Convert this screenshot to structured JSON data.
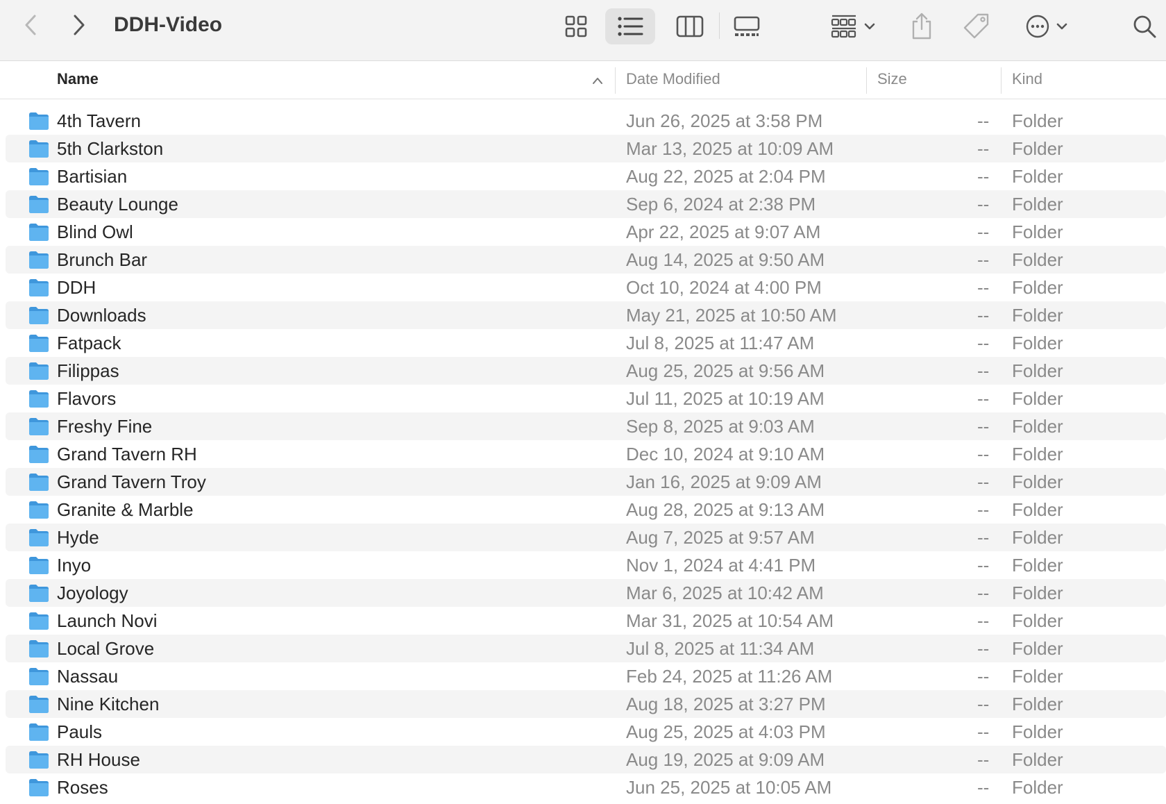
{
  "window": {
    "title": "DDH-Video"
  },
  "toolbar": {
    "back_icon": "chevron-left-icon",
    "forward_icon": "chevron-right-icon",
    "view_modes": [
      "icon-view",
      "list-view",
      "column-view",
      "gallery-view"
    ],
    "active_view": "list-view",
    "icons": [
      "group-icon",
      "share-icon",
      "tag-icon",
      "more-icon",
      "search-icon"
    ]
  },
  "columns": {
    "name": "Name",
    "date_modified": "Date Modified",
    "size": "Size",
    "kind": "Kind",
    "sort_column": "name",
    "sort_direction": "ascending"
  },
  "colors": {
    "folder": "#5fb4f0",
    "folder_tab": "#3f97dc",
    "row_alt": "#f4f4f4",
    "toolbar_bg": "#f3f3f3",
    "active_view_bg": "#e2e2e2"
  },
  "files": [
    {
      "name": "4th Tavern",
      "date": "Jun 26, 2025 at 3:58 PM",
      "size": "--",
      "kind": "Folder"
    },
    {
      "name": "5th Clarkston",
      "date": "Mar 13, 2025 at 10:09 AM",
      "size": "--",
      "kind": "Folder"
    },
    {
      "name": "Bartisian",
      "date": "Aug 22, 2025 at 2:04 PM",
      "size": "--",
      "kind": "Folder"
    },
    {
      "name": "Beauty Lounge",
      "date": "Sep 6, 2024 at 2:38 PM",
      "size": "--",
      "kind": "Folder"
    },
    {
      "name": "Blind Owl",
      "date": "Apr 22, 2025 at 9:07 AM",
      "size": "--",
      "kind": "Folder"
    },
    {
      "name": "Brunch Bar",
      "date": "Aug 14, 2025 at 9:50 AM",
      "size": "--",
      "kind": "Folder"
    },
    {
      "name": "DDH",
      "date": "Oct 10, 2024 at 4:00 PM",
      "size": "--",
      "kind": "Folder"
    },
    {
      "name": "Downloads",
      "date": "May 21, 2025 at 10:50 AM",
      "size": "--",
      "kind": "Folder"
    },
    {
      "name": "Fatpack",
      "date": "Jul 8, 2025 at 11:47 AM",
      "size": "--",
      "kind": "Folder"
    },
    {
      "name": "Filippas",
      "date": "Aug 25, 2025 at 9:56 AM",
      "size": "--",
      "kind": "Folder"
    },
    {
      "name": "Flavors",
      "date": "Jul 11, 2025 at 10:19 AM",
      "size": "--",
      "kind": "Folder"
    },
    {
      "name": "Freshy Fine",
      "date": "Sep 8, 2025 at 9:03 AM",
      "size": "--",
      "kind": "Folder"
    },
    {
      "name": "Grand Tavern RH",
      "date": "Dec 10, 2024 at 9:10 AM",
      "size": "--",
      "kind": "Folder"
    },
    {
      "name": "Grand Tavern Troy",
      "date": "Jan 16, 2025 at 9:09 AM",
      "size": "--",
      "kind": "Folder"
    },
    {
      "name": "Granite & Marble",
      "date": "Aug 28, 2025 at 9:13 AM",
      "size": "--",
      "kind": "Folder"
    },
    {
      "name": "Hyde",
      "date": "Aug 7, 2025 at 9:57 AM",
      "size": "--",
      "kind": "Folder"
    },
    {
      "name": "Inyo",
      "date": "Nov 1, 2024 at 4:41 PM",
      "size": "--",
      "kind": "Folder"
    },
    {
      "name": "Joyology",
      "date": "Mar 6, 2025 at 10:42 AM",
      "size": "--",
      "kind": "Folder"
    },
    {
      "name": "Launch Novi",
      "date": "Mar 31, 2025 at 10:54 AM",
      "size": "--",
      "kind": "Folder"
    },
    {
      "name": "Local Grove",
      "date": "Jul 8, 2025 at 11:34 AM",
      "size": "--",
      "kind": "Folder"
    },
    {
      "name": "Nassau",
      "date": "Feb 24, 2025 at 11:26 AM",
      "size": "--",
      "kind": "Folder"
    },
    {
      "name": "Nine Kitchen",
      "date": "Aug 18, 2025 at 3:27 PM",
      "size": "--",
      "kind": "Folder"
    },
    {
      "name": "Pauls",
      "date": "Aug 25, 2025 at 4:03 PM",
      "size": "--",
      "kind": "Folder"
    },
    {
      "name": "RH House",
      "date": "Aug 19, 2025 at 9:09 AM",
      "size": "--",
      "kind": "Folder"
    },
    {
      "name": "Roses",
      "date": "Jun 25, 2025 at 10:05 AM",
      "size": "--",
      "kind": "Folder"
    }
  ]
}
